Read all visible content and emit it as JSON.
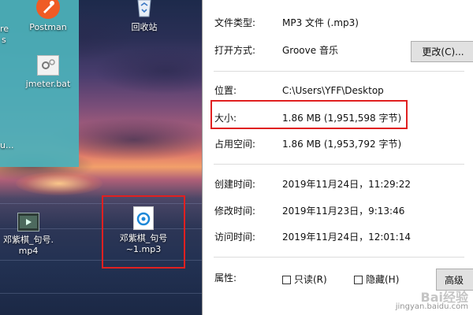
{
  "desktop": {
    "icons": {
      "postman": {
        "label": "Postman",
        "icon": "postman-logo-icon"
      },
      "recycle_bin": {
        "label": "回收站",
        "icon": "recycle-bin-icon"
      },
      "jmeter": {
        "label": "jmeter.bat",
        "icon": "gear-bat-file-icon"
      },
      "video": {
        "label_line1": "邓紫棋_句号.",
        "label_line2": "mp4",
        "icon": "video-file-icon"
      },
      "mp3": {
        "label_line1": "邓紫棋_句号",
        "label_line2": "~1.mp3",
        "icon": "mp3-file-icon"
      }
    },
    "partial_labels": {
      "top_left": "re",
      "top_left_2": "s",
      "middle_left": "u..."
    }
  },
  "dialog": {
    "file_type": {
      "label": "文件类型:",
      "value": "MP3 文件 (.mp3)"
    },
    "opens_with": {
      "label": "打开方式:",
      "value": "Groove 音乐",
      "button": "更改(C)..."
    },
    "location": {
      "label": "位置:",
      "value": "C:\\Users\\YFF\\Desktop"
    },
    "size": {
      "label": "大小:",
      "value": "1.86 MB (1,951,598 字节)"
    },
    "size_on_disk": {
      "label": "占用空间:",
      "value": "1.86 MB (1,953,792 字节)"
    },
    "created": {
      "label": "创建时间:",
      "value": "2019年11月24日，11:29:22"
    },
    "modified": {
      "label": "修改时间:",
      "value": "2019年11月23日，9:13:46"
    },
    "accessed": {
      "label": "访问时间:",
      "value": "2019年11月24日，12:01:14"
    },
    "attributes": {
      "label": "属性:",
      "readonly": "只读(R)",
      "hidden": "隐藏(H)",
      "advanced_button": "高级"
    }
  },
  "watermark": {
    "line1": "Bai经验",
    "line2": "jingyan.baidu.com"
  },
  "colors": {
    "highlight_red": "#e02020",
    "postman_orange": "#ef5b25",
    "teal_window": "#4cb2ba"
  }
}
